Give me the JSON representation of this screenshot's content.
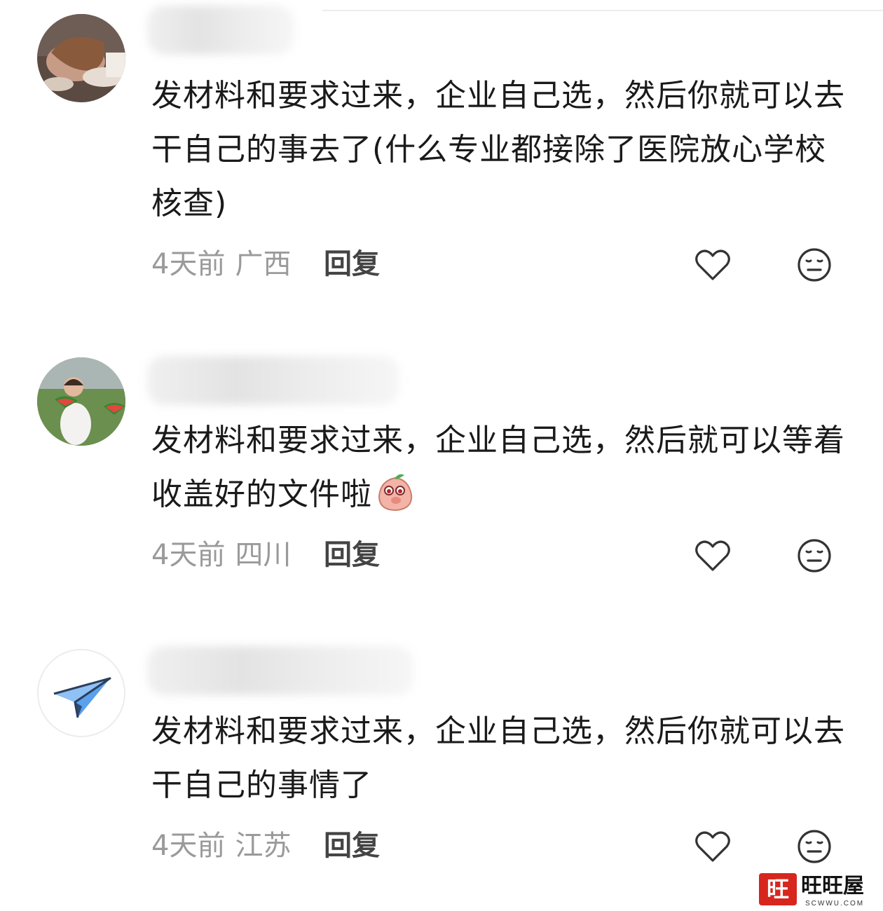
{
  "comments": [
    {
      "avatar": "avatar-girl-with-food",
      "text": "发材料和要求过来，企业自己选，然后你就可以去干自己的事去了(什么专业都接除了医院放心学校核查)",
      "time": "4天前",
      "region": "广西",
      "reply_label": "回复"
    },
    {
      "avatar": "avatar-watermelon-kids",
      "text": "发材料和要求过来，企业自己选，然后就可以等着收盖好的文件啦",
      "emoji": "peach-blush-emoji",
      "time": "4天前",
      "region": "四川",
      "reply_label": "回复"
    },
    {
      "avatar": "avatar-paper-plane",
      "text": "发材料和要求过来，企业自己选，然后你就可以去干自己的事情了",
      "time": "4天前",
      "region": "江苏",
      "reply_label": "回复"
    }
  ],
  "icons": {
    "like": "heart-outline-icon",
    "dislike": "meh-face-icon"
  },
  "colors": {
    "text": "#1a1a1a",
    "meta": "#9a9a9a",
    "accent": "#4a90e2",
    "watermark": "#d7261e"
  },
  "watermark": {
    "badge": "旺",
    "name": "旺旺屋",
    "site": "SCWWU.COM"
  }
}
